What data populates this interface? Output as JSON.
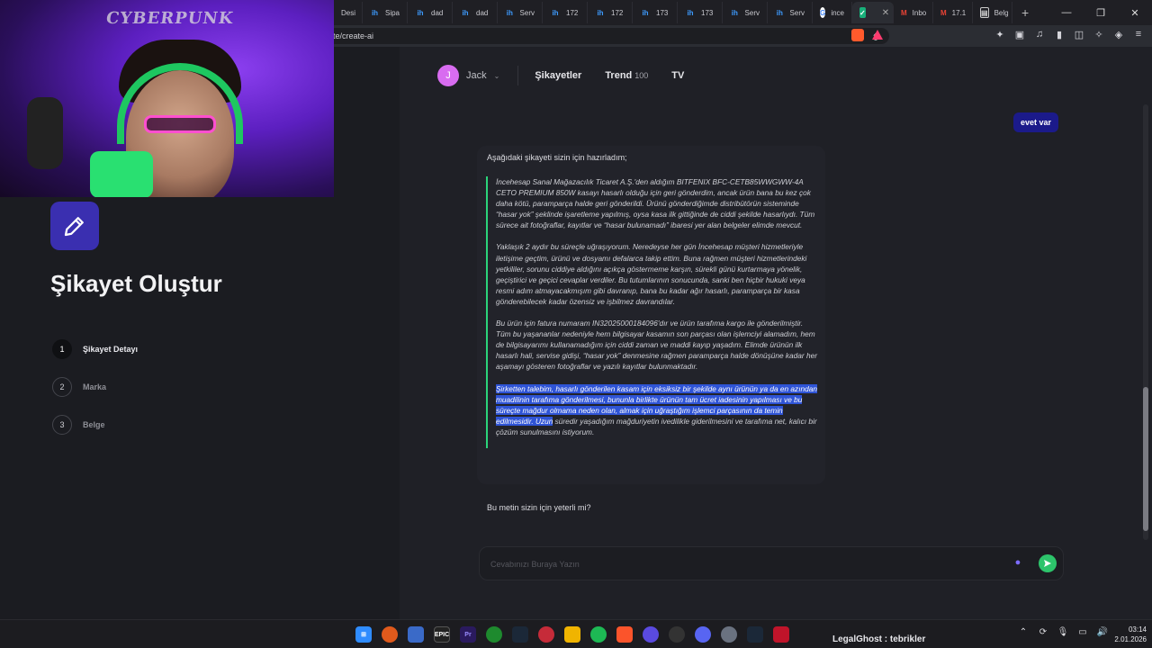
{
  "browser": {
    "tabs": [
      {
        "label": "Desi",
        "icon": "generic-tab-icon"
      },
      {
        "label": "Sipa",
        "icon": "ih-icon"
      },
      {
        "label": "dad",
        "icon": "ih-icon"
      },
      {
        "label": "dad",
        "icon": "ih-icon"
      },
      {
        "label": "Serv",
        "icon": "ih-icon"
      },
      {
        "label": "172",
        "icon": "ih-icon"
      },
      {
        "label": "172",
        "icon": "ih-icon"
      },
      {
        "label": "173",
        "icon": "ih-icon"
      },
      {
        "label": "173",
        "icon": "ih-icon"
      },
      {
        "label": "Serv",
        "icon": "ih-icon"
      },
      {
        "label": "Serv",
        "icon": "ih-icon"
      },
      {
        "label": "ince",
        "icon": "google-icon"
      },
      {
        "label": "",
        "icon": "check-icon",
        "active": true
      },
      {
        "label": "Inbo",
        "icon": "gmail-icon"
      },
      {
        "label": "17.1",
        "icon": "gmail-icon"
      },
      {
        "label": "Belg",
        "icon": "doc-icon"
      }
    ],
    "url": "te/create-ai"
  },
  "webcam": {
    "logo_text": "CYBERPUNK"
  },
  "header": {
    "avatar_letter": "J",
    "username": "Jack",
    "nav": {
      "complaints": "Şikayetler",
      "trend": "Trend",
      "trend_count": "100",
      "tv": "TV"
    }
  },
  "sidebar": {
    "title": "Şikayet Oluştur",
    "steps": [
      {
        "num": "1",
        "label": "Şikayet Detayı",
        "active": true
      },
      {
        "num": "2",
        "label": "Marka",
        "active": false
      },
      {
        "num": "3",
        "label": "Belge",
        "active": false
      }
    ]
  },
  "chat": {
    "user_message": "evet var",
    "ai_intro": "Aşağıdaki şikayeti sizin için hazırladım;",
    "paragraphs": [
      "İncehesap Sanal Mağazacılık Ticaret A.Ş.'den aldığım BITFENIX BFC-CETB85WWGWW-4A CETO PREMIUM 850W kasayı hasarlı olduğu için geri gönderdim, ancak ürün bana bu kez çok daha kötü, paramparça halde geri gönderildi. Ürünü gönderdiğimde distribütörün sisteminde “hasar yok” şeklinde işaretleme yapılmış, oysa kasa ilk gittiğinde de ciddi şekilde hasarlıydı. Tüm sürece ait fotoğraflar, kayıtlar ve “hasar bulunamadı” ibaresi yer alan belgeler elimde mevcut.",
      "Yaklaşık 2 aydır bu süreçle uğraşıyorum. Neredeyse her gün İncehesap müşteri hizmetleriyle iletişime geçtim, ürünü ve dosyamı defalarca takip ettim. Buna rağmen müşteri hizmetlerindeki yetkililer, sorunu ciddiye aldığını açıkça göstermeme karşın, sürekli günü kurtarmaya yönelik, geçiştirici ve geçici cevaplar verdiler. Bu tutumlarının sonucunda, sanki ben hiçbir hukuki veya resmi adım atmayacakmışım gibi davranıp, bana bu kadar ağır hasarlı, paramparça bir kasa gönderebilecek kadar özensiz ve işbilmez davrandılar.",
      "Bu ürün için fatura numaram IN32025000184096'dır ve ürün tarafıma kargo ile gönderilmiştir. Tüm bu yaşananlar nedeniyle hem bilgisayar kasamın son parçası olan işlemciyi alamadım, hem de bilgisayarımı kullanamadığım için ciddi zaman ve maddi kayıp yaşadım. Elimde ürünün ilk hasarlı hali, servise gidişi, “hasar yok” denmesine rağmen paramparça halde dönüşüne kadar her aşamayı gösteren fotoğraflar ve yazılı kayıtlar bulunmaktadır."
    ],
    "last_paragraph_highlighted": "Şirketten talebim, hasarlı gönderilen kasam için eksiksiz bir şekilde aynı ürünün ya da en azından muadilinin tarafıma gönderilmesi, bununla birlikte ürünün tam ücret iadesinin yapılması ve bu süreçte mağdur olmama neden olan, almak için uğraştığım işlemci parçasının da temin edilmesidir. Uzun",
    "last_paragraph_rest": " süredir yaşadığım mağduriyetin ivedilikle giderilmesini ve tarafıma net, kalıcı bir çözüm sunulmasını istiyorum.",
    "followup": "Bu metin sizin için yeterli mi?",
    "input_placeholder": "Cevabınızı Buraya Yazın"
  },
  "taskbar": {
    "chat_text": "LegalGhost : tebrikler",
    "time": "03:14",
    "date": "2.01.2026"
  },
  "colors": {
    "accent_purple": "#3a2fb0",
    "user_bubble": "#1b1a8a",
    "quote_border": "#2bd47a",
    "send_button": "#2dc46b",
    "highlight": "#2f54d6"
  }
}
